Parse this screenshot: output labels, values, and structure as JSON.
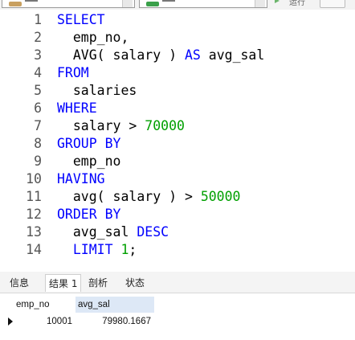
{
  "toolbar": {
    "run_label": "运行"
  },
  "editor": {
    "lines": [
      {
        "n": "1",
        "tokens": [
          {
            "t": "SELECT",
            "k": "kw"
          }
        ]
      },
      {
        "n": "2",
        "tokens": [
          {
            "t": "  emp_no,",
            "k": "id"
          }
        ]
      },
      {
        "n": "3",
        "tokens": [
          {
            "t": "  AVG( salary ) ",
            "k": "id"
          },
          {
            "t": "AS",
            "k": "kw"
          },
          {
            "t": " avg_sal",
            "k": "id"
          }
        ]
      },
      {
        "n": "4",
        "tokens": [
          {
            "t": "FROM",
            "k": "kw"
          }
        ]
      },
      {
        "n": "5",
        "tokens": [
          {
            "t": "  salaries",
            "k": "id"
          }
        ]
      },
      {
        "n": "6",
        "tokens": [
          {
            "t": "WHERE",
            "k": "kw"
          }
        ]
      },
      {
        "n": "7",
        "tokens": [
          {
            "t": "  salary > ",
            "k": "id"
          },
          {
            "t": "70000",
            "k": "num"
          }
        ]
      },
      {
        "n": "8",
        "tokens": [
          {
            "t": "GROUP BY",
            "k": "kw"
          }
        ]
      },
      {
        "n": "9",
        "tokens": [
          {
            "t": "  emp_no",
            "k": "id"
          }
        ]
      },
      {
        "n": "10",
        "tokens": [
          {
            "t": "HAVING",
            "k": "kw"
          }
        ]
      },
      {
        "n": "11",
        "tokens": [
          {
            "t": "  avg( salary ) > ",
            "k": "id"
          },
          {
            "t": "50000",
            "k": "num"
          }
        ]
      },
      {
        "n": "12",
        "tokens": [
          {
            "t": "ORDER BY",
            "k": "kw"
          }
        ]
      },
      {
        "n": "13",
        "tokens": [
          {
            "t": "  avg_sal ",
            "k": "id"
          },
          {
            "t": "DESC",
            "k": "kw"
          }
        ]
      },
      {
        "n": "14",
        "tokens": [
          {
            "t": "  ",
            "k": "id"
          },
          {
            "t": "LIMIT",
            "k": "kw"
          },
          {
            "t": " ",
            "k": "id"
          },
          {
            "t": "1",
            "k": "num"
          },
          {
            "t": ";",
            "k": "id"
          }
        ]
      }
    ]
  },
  "result_tabs": [
    {
      "label": "信息",
      "active": false
    },
    {
      "label": "结果 1",
      "active": true
    },
    {
      "label": "剖析",
      "active": false
    },
    {
      "label": "状态",
      "active": false
    }
  ],
  "result": {
    "columns": [
      "emp_no",
      "avg_sal"
    ],
    "rows": [
      [
        "10001",
        "79980.1667"
      ]
    ]
  },
  "colors": {
    "keyword": "#0000ff",
    "number": "#00a000",
    "identifier": "#000000"
  }
}
